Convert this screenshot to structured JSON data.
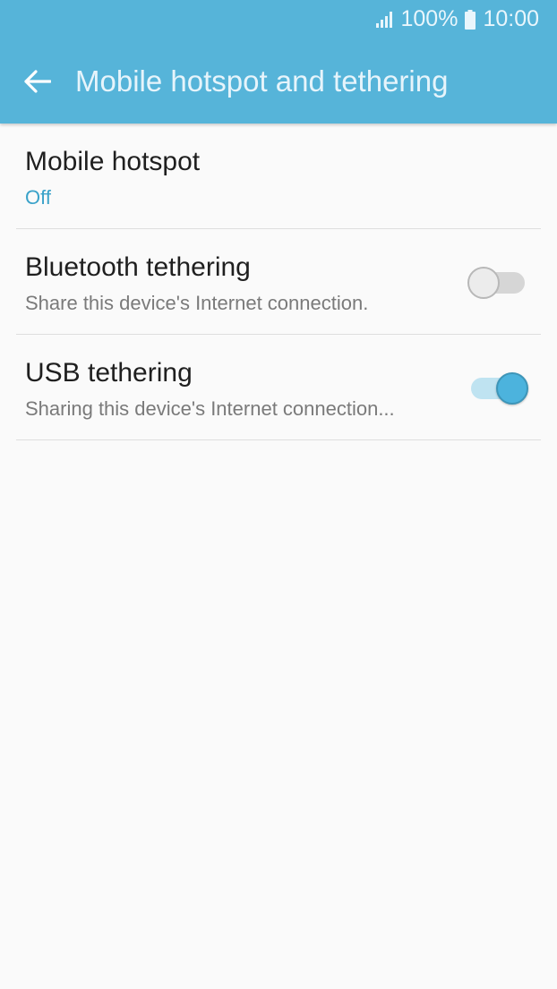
{
  "status_bar": {
    "signal_icon": "signal-icon",
    "battery_percent": "100%",
    "battery_icon": "battery-icon",
    "time": "10:00"
  },
  "header": {
    "back_icon": "arrow-left-icon",
    "title": "Mobile hotspot and tethering"
  },
  "items": [
    {
      "title": "Mobile hotspot",
      "subtitle": "Off",
      "has_toggle": false
    },
    {
      "title": "Bluetooth tethering",
      "subtitle": "Share this device's Internet connection.",
      "has_toggle": true,
      "toggle_on": false
    },
    {
      "title": "USB tethering",
      "subtitle": "Sharing this device's Internet connection...",
      "has_toggle": true,
      "toggle_on": true
    }
  ],
  "colors": {
    "header_bg": "#56b4d9",
    "accent": "#3aa2c9",
    "toggle_on": "#4cb3dd",
    "background": "#fafafa"
  }
}
